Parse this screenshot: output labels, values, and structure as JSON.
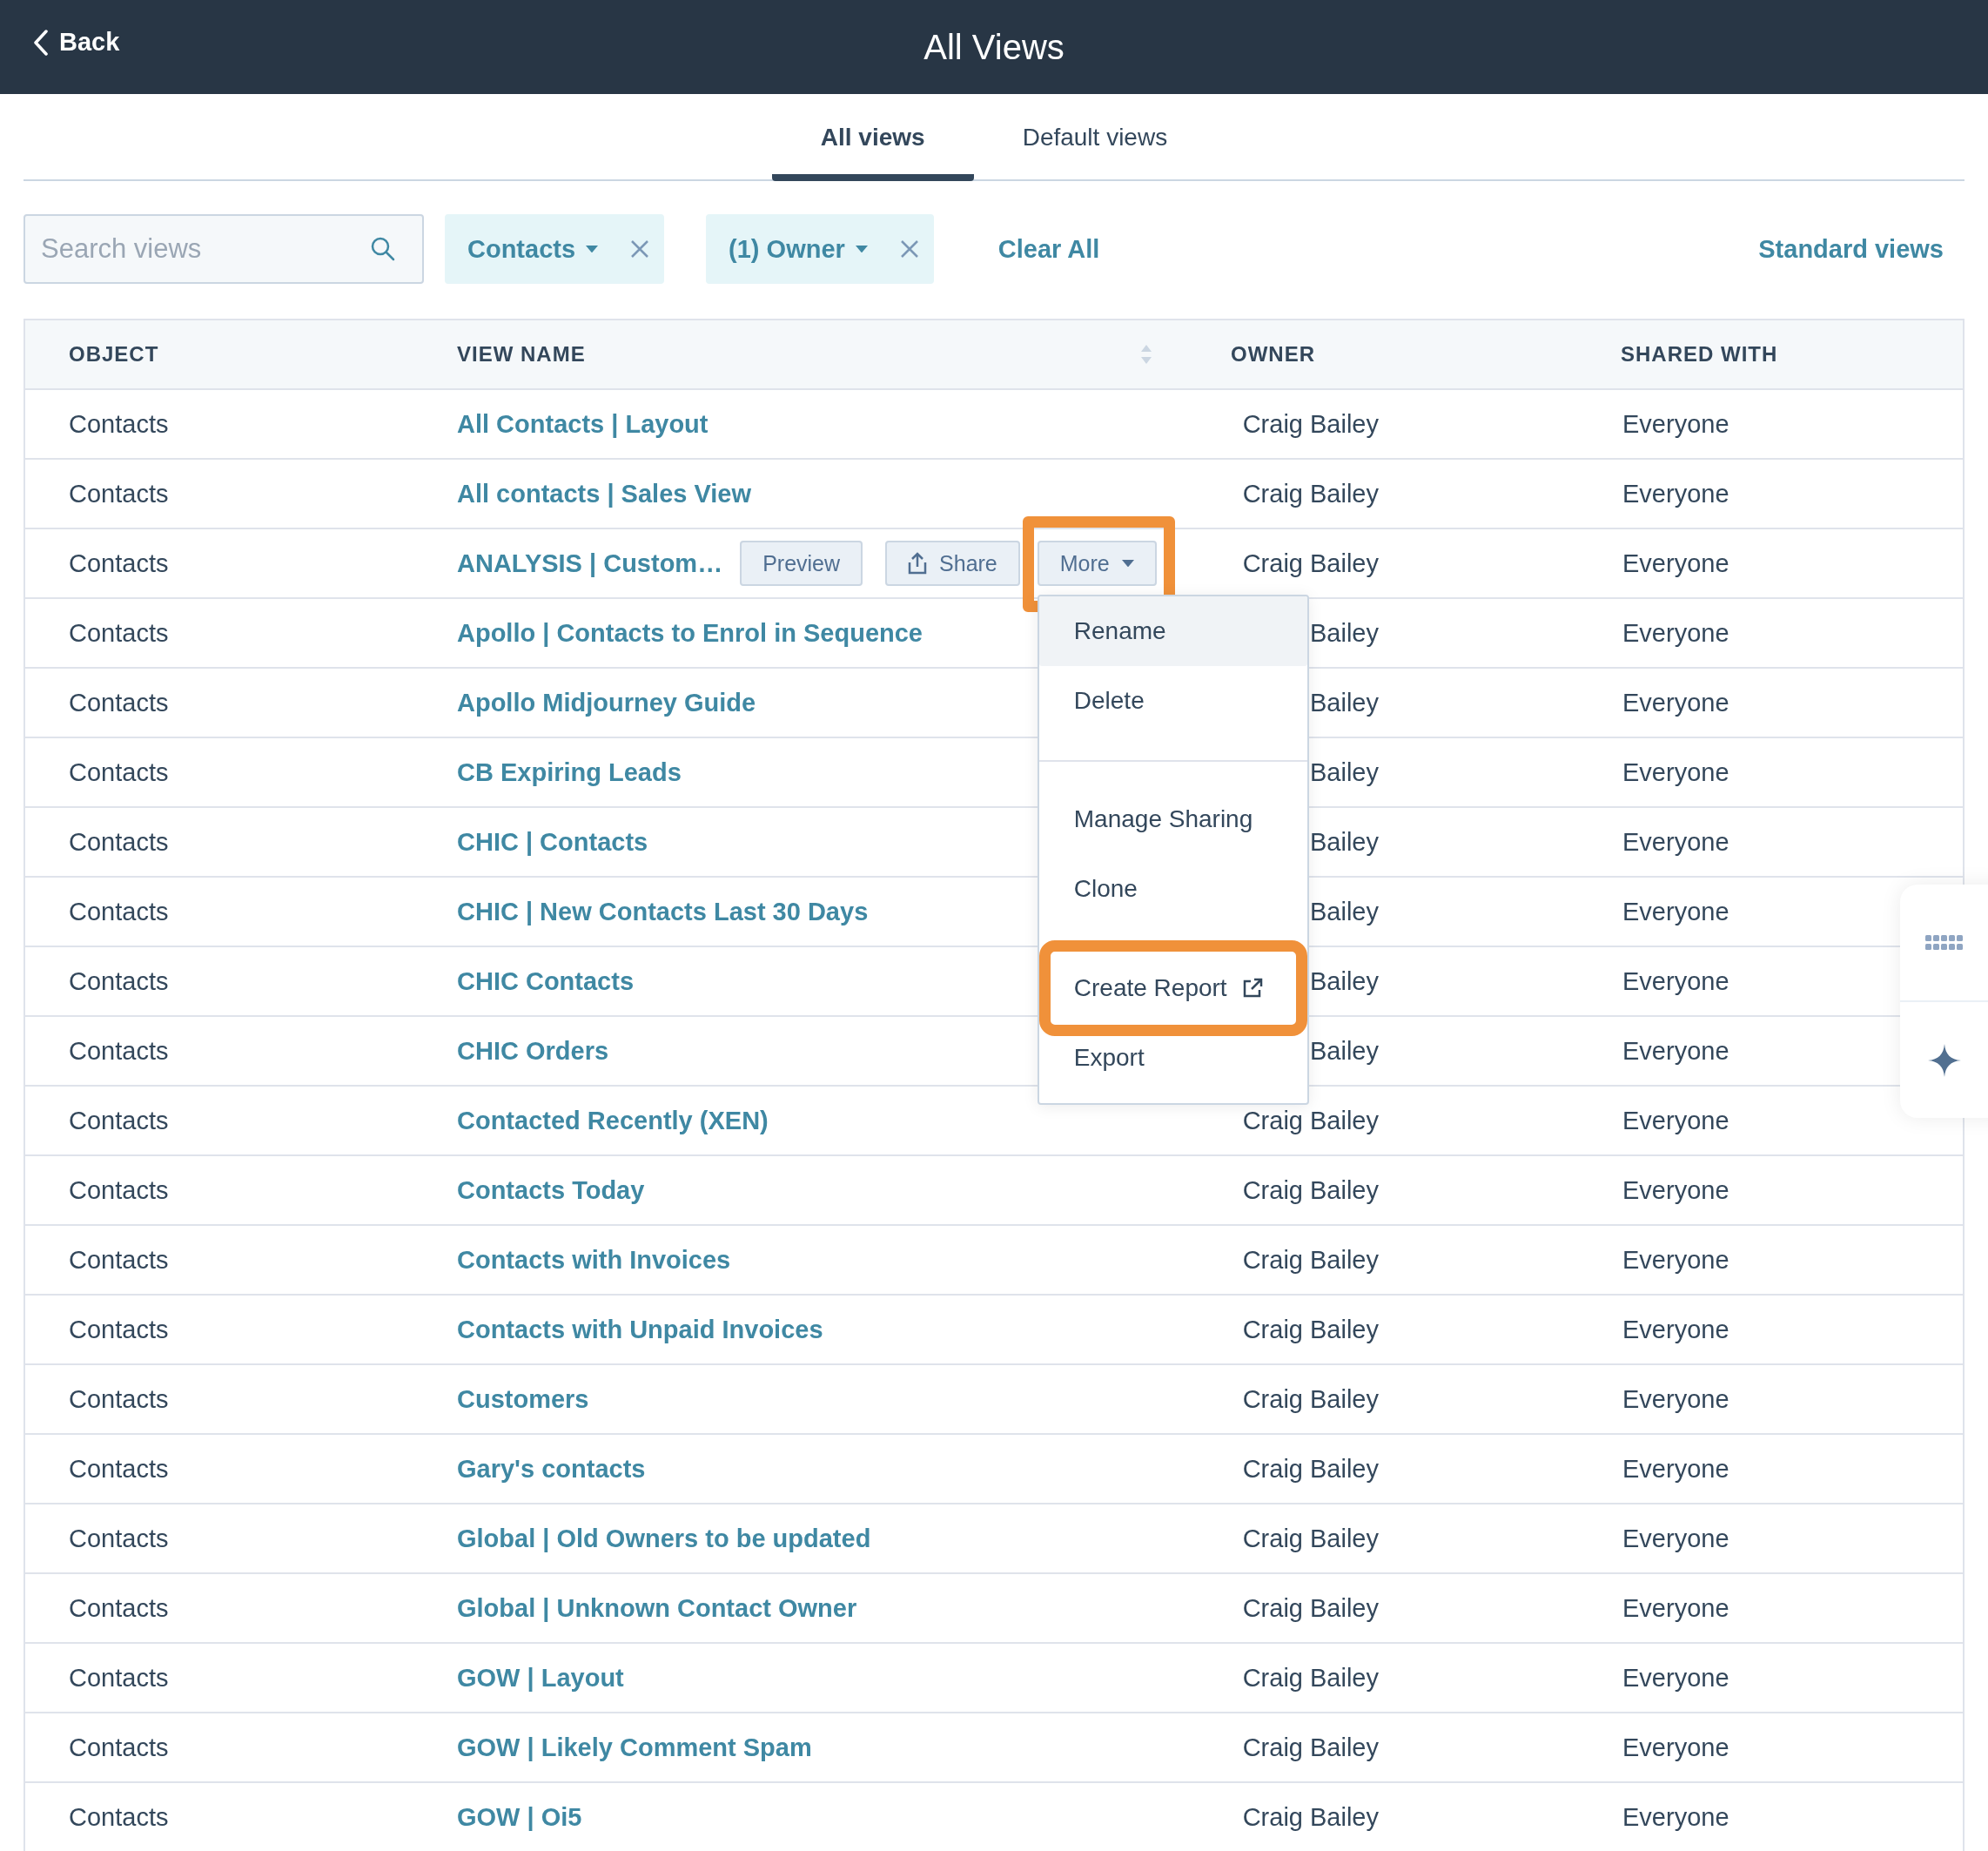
{
  "header": {
    "back": "Back",
    "title": "All Views"
  },
  "tabs": [
    {
      "label": "All views",
      "selected": true
    },
    {
      "label": "Default views",
      "selected": false
    }
  ],
  "filters": {
    "search": {
      "placeholder": "Search views"
    },
    "chips": [
      {
        "label": "Contacts"
      },
      {
        "label": "(1) Owner"
      }
    ],
    "clear": "Clear All",
    "standard": "Standard views"
  },
  "table": {
    "columns": [
      {
        "label": "OBJECT",
        "sortable": false
      },
      {
        "label": "VIEW NAME",
        "sortable": true
      },
      {
        "label": "OWNER",
        "sortable": false
      },
      {
        "label": "SHARED WITH",
        "sortable": false
      }
    ],
    "rows": [
      {
        "object": "Contacts",
        "name": "All Contacts | Layout",
        "owner": "Craig Bailey",
        "shared": "Everyone"
      },
      {
        "object": "Contacts",
        "name": "All contacts | Sales View",
        "owner": "Craig Bailey",
        "shared": "Everyone"
      },
      {
        "object": "Contacts",
        "name": "ANALYSIS | Custom…",
        "owner": "Craig Bailey",
        "shared": "Everyone",
        "actions": {
          "preview": "Preview",
          "share": "Share",
          "more": "More",
          "more_highlighted": true,
          "menu_groups": [
            {
              "items": [
                {
                  "label": "Rename",
                  "hovered": true,
                  "highlighted": false,
                  "external": false
                },
                {
                  "label": "Delete",
                  "hovered": false,
                  "highlighted": false,
                  "external": false
                }
              ]
            },
            {
              "items": [
                {
                  "label": "Manage Sharing",
                  "hovered": false,
                  "highlighted": false,
                  "external": false
                },
                {
                  "label": "Clone",
                  "hovered": false,
                  "highlighted": false,
                  "external": false
                },
                {
                  "label": "Create Report",
                  "hovered": false,
                  "highlighted": true,
                  "external": true
                },
                {
                  "label": "Export",
                  "hovered": false,
                  "highlighted": false,
                  "external": false
                }
              ]
            }
          ]
        }
      },
      {
        "object": "Contacts",
        "name": "Apollo | Contacts to Enrol in Sequence",
        "owner": "Bailey",
        "shared": "Everyone"
      },
      {
        "object": "Contacts",
        "name": "Apollo Midjourney Guide",
        "owner": "Bailey",
        "shared": "Everyone"
      },
      {
        "object": "Contacts",
        "name": "CB Expiring Leads",
        "owner": "Bailey",
        "shared": "Everyone"
      },
      {
        "object": "Contacts",
        "name": "CHIC | Contacts",
        "owner": "Bailey",
        "shared": "Everyone"
      },
      {
        "object": "Contacts",
        "name": "CHIC | New Contacts Last 30 Days",
        "owner": "Bailey",
        "shared": "Everyone"
      },
      {
        "object": "Contacts",
        "name": "CHIC Contacts",
        "owner": "Bailey",
        "shared": "Everyone"
      },
      {
        "object": "Contacts",
        "name": "CHIC Orders",
        "owner": "Bailey",
        "shared": "Everyone"
      },
      {
        "object": "Contacts",
        "name": "Contacted Recently (XEN)",
        "owner": "Craig Bailey",
        "shared": "Everyone"
      },
      {
        "object": "Contacts",
        "name": "Contacts Today",
        "owner": "Craig Bailey",
        "shared": "Everyone"
      },
      {
        "object": "Contacts",
        "name": "Contacts with Invoices",
        "owner": "Craig Bailey",
        "shared": "Everyone"
      },
      {
        "object": "Contacts",
        "name": "Contacts with Unpaid Invoices",
        "owner": "Craig Bailey",
        "shared": "Everyone"
      },
      {
        "object": "Contacts",
        "name": "Customers",
        "owner": "Craig Bailey",
        "shared": "Everyone"
      },
      {
        "object": "Contacts",
        "name": "Gary's contacts",
        "owner": "Craig Bailey",
        "shared": "Everyone"
      },
      {
        "object": "Contacts",
        "name": "Global | Old Owners to be updated",
        "owner": "Craig Bailey",
        "shared": "Everyone"
      },
      {
        "object": "Contacts",
        "name": "Global | Unknown Contact Owner",
        "owner": "Craig Bailey",
        "shared": "Everyone"
      },
      {
        "object": "Contacts",
        "name": "GOW | Layout",
        "owner": "Craig Bailey",
        "shared": "Everyone"
      },
      {
        "object": "Contacts",
        "name": "GOW | Likely Comment Spam",
        "owner": "Craig Bailey",
        "shared": "Everyone"
      },
      {
        "object": "Contacts",
        "name": "GOW | Oi5",
        "owner": "Craig Bailey",
        "shared": "Everyone"
      }
    ]
  }
}
